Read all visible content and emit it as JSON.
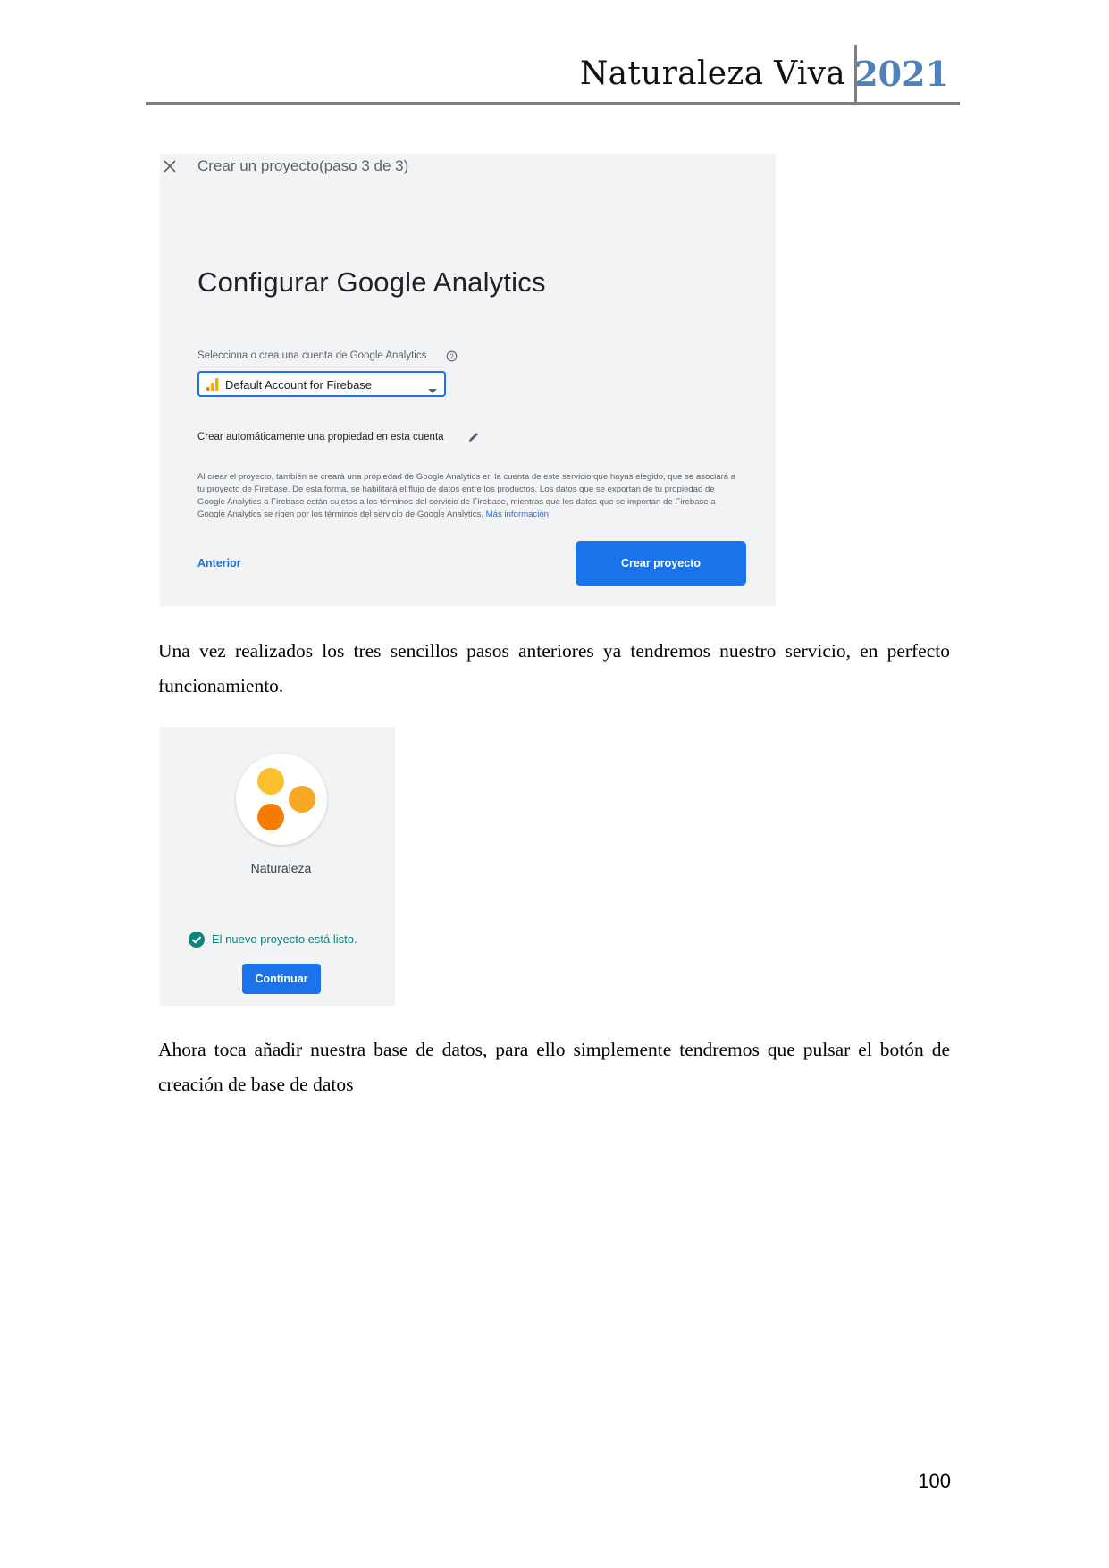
{
  "header": {
    "title": "Naturaleza Viva",
    "year": "2021"
  },
  "screenshot1": {
    "step": "Crear un proyecto(paso 3 de 3)",
    "heading": "Configurar Google Analytics",
    "account_label": "Selecciona o crea una cuenta de Google Analytics",
    "account_value": "Default Account for Firebase",
    "auto_property_label": "Crear automáticamente una propiedad en esta cuenta",
    "legal_text": "Al crear el proyecto, también se creará una propiedad de Google Analytics en la cuenta de este servicio que hayas elegido, que se asociará a tu proyecto de Firebase. De esta forma, se habilitará el flujo de datos entre los productos. Los datos que se exportan de tu propiedad de Google Analytics a Firebase están sujetos a los términos del servicio de Firebase, mientras que los datos que se importan de Firebase a Google Analytics se rigen por los términos del servicio de Google Analytics.",
    "legal_link": "Más información",
    "back_label": "Anterior",
    "create_label": "Crear proyecto",
    "accent_color": "#1a73e8",
    "icons": [
      "close-icon",
      "help-icon",
      "analytics-bars-icon",
      "dropdown-caret-icon",
      "pencil-icon"
    ]
  },
  "paragraph1": "Una vez realizados los tres sencillos pasos anteriores ya tendremos nuestro servicio, en perfecto funcionamiento.",
  "screenshot2": {
    "project_name": "Naturaleza",
    "ready_text": "El nuevo proyecto está listo.",
    "continue_label": "Continuar",
    "logo_colors": [
      "#fbc02d",
      "#f9a825",
      "#f57c00"
    ],
    "icons": [
      "project-logo-icon",
      "check-circle-icon"
    ]
  },
  "paragraph2": "Ahora toca añadir nuestra base de datos, para ello simplemente tendremos que pulsar el botón de creación de base de datos",
  "page_number": "100"
}
